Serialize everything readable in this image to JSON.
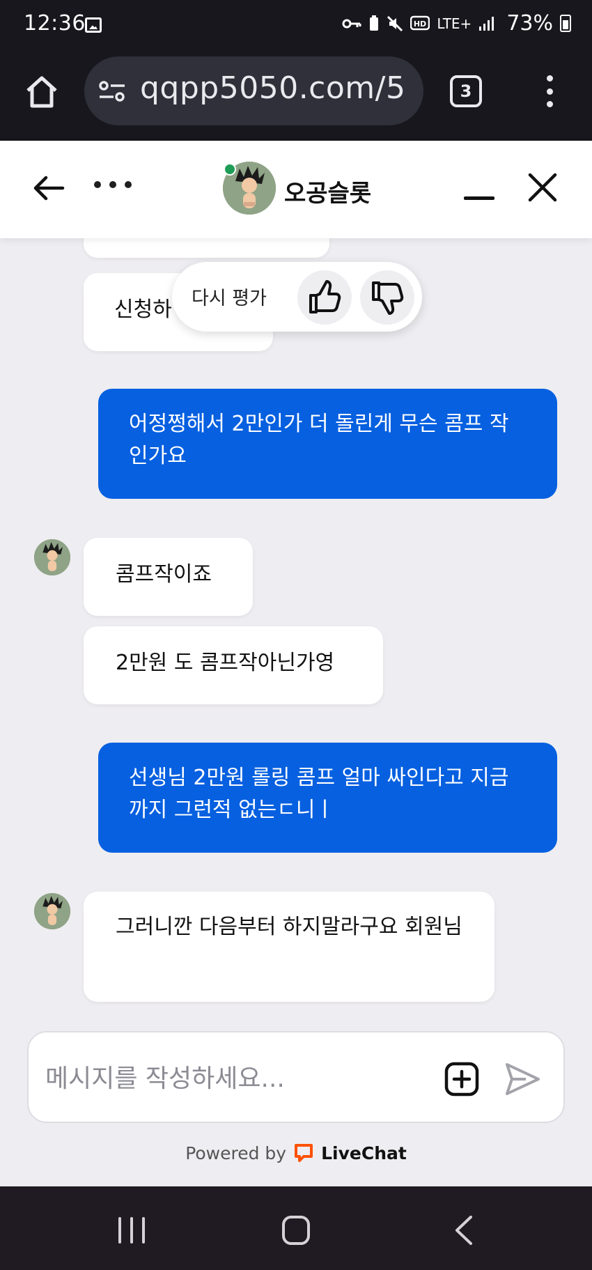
{
  "status_bar": {
    "time": "12:36",
    "network_label": "LTE+",
    "battery_percent": "73%"
  },
  "browser": {
    "url": "qqpp5050.com/5",
    "tab_count": "3"
  },
  "chat_header": {
    "agent_name": "오공슬롯",
    "online": true,
    "online_color": "#1f9d57"
  },
  "rating": {
    "label": "다시 평가"
  },
  "messages": [
    {
      "from": "agent",
      "text": "신청하"
    },
    {
      "from": "user",
      "text": "어정쩡해서 2만인가 더 돌린게 무슨 콤프 작인가요"
    },
    {
      "from": "agent",
      "text": "콤프작이죠"
    },
    {
      "from": "agent",
      "text": "2만원 도 콤프작아닌가영"
    },
    {
      "from": "user",
      "text": "선생님 2만원 롤링 콤프 얼마 싸인다고 지금까지 그런적 없는ㄷ니ㅣ"
    },
    {
      "from": "agent",
      "text": "그러니깐 다음부터 하지말라구요 회원님"
    }
  ],
  "composer": {
    "placeholder": "메시지를 작성하세요..."
  },
  "footer": {
    "powered_prefix": "Powered by",
    "brand": "LiveChat",
    "brand_color": "#ff5100"
  },
  "colors": {
    "user_bubble": "#0660e0",
    "agent_bubble": "#ffffff",
    "chat_background": "#eeedf1"
  }
}
